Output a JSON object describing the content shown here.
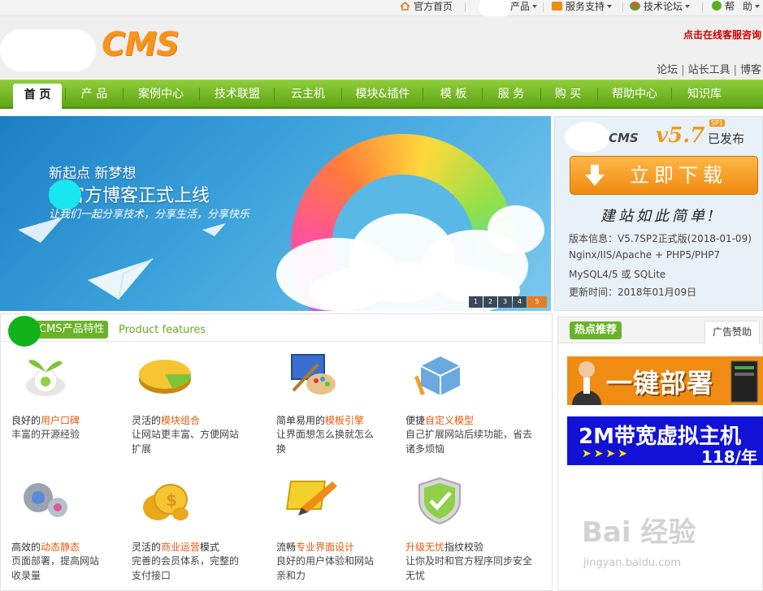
{
  "topbar": {
    "home": "官方首页",
    "products": "产品",
    "service": "服务支持",
    "forum": "技术论坛",
    "help": "帮",
    "assist": "助"
  },
  "header": {
    "logo_text": "CMS",
    "online_service": "点击在线客服咨询",
    "links": [
      "论坛",
      "站长工具",
      "博客"
    ]
  },
  "nav": {
    "items": [
      "首 页",
      "产 品",
      "案例中心",
      "技术联盟",
      "云主机",
      "模块&插件",
      "模 板",
      "服 务",
      "购 买",
      "帮助中心",
      "知识库"
    ]
  },
  "banner": {
    "line1": "新起点 新梦想",
    "line2": "梦官方博客正式上线",
    "line3": "让我们一起分享技术，分享生活，分享快乐",
    "pages": [
      "1",
      "2",
      "3",
      "4",
      "5"
    ]
  },
  "download": {
    "brand": "CMS",
    "version": "v5.7",
    "sp_badge": "SP1",
    "published": "已发布",
    "button": "立即下载",
    "slogan": "建站如此简单!",
    "info": [
      "版本信息：V5.7SP2正式版(2018-01-09)",
      "Nginx/IIS/Apache + PHP5/PHP7",
      "MySQL4/5 或 SQLite",
      "更新时间：2018年01月09日"
    ]
  },
  "features": {
    "tag": "CMS产品特性",
    "en_title": "Product features",
    "items": [
      {
        "pre": "良好的",
        "hl": "用户口碑",
        "post": "",
        "desc": "丰富的开源经验"
      },
      {
        "pre": "灵活的",
        "hl": "模块组合",
        "post": "",
        "desc": "让网站更丰富、方便网站扩展"
      },
      {
        "pre": "简单易用的",
        "hl": "模板引擎",
        "post": "",
        "desc": "让界面想怎么换就怎么换"
      },
      {
        "pre": "便捷",
        "hl": "自定义模型",
        "post": "",
        "desc": "自己扩展网站后续功能，省去诸多烦恼"
      },
      {
        "pre": "高效的",
        "hl": "动态静态",
        "post": "",
        "desc": "页面部署，提高网站收录量"
      },
      {
        "pre": "灵活的",
        "hl": "商业运营",
        "post": "模式",
        "desc": "完善的会员体系，完整的支付接口"
      },
      {
        "pre": "流畅",
        "hl": "专业界面设计",
        "post": "",
        "desc": "良好的用户体验和网站亲和力"
      },
      {
        "pre": "",
        "hl": "升级无忧",
        "post": "指纹校验",
        "desc": "让你及时和官方程序同步安全无忧"
      }
    ]
  },
  "hot": {
    "tag": "热点推荐",
    "tab": "广告赞助",
    "ad1": "一键部署",
    "ad2_title": "2M带宽虚拟主机",
    "ad2_arrows": "➤➤➤➤",
    "ad2_price": "118/年"
  },
  "watermark": {
    "brand": "Bai 经验",
    "url": "jingyan.baidu.com"
  },
  "colors": {
    "nav_green": "#5ea514",
    "accent_orange": "#f08a10",
    "highlight": "#e8590c"
  }
}
